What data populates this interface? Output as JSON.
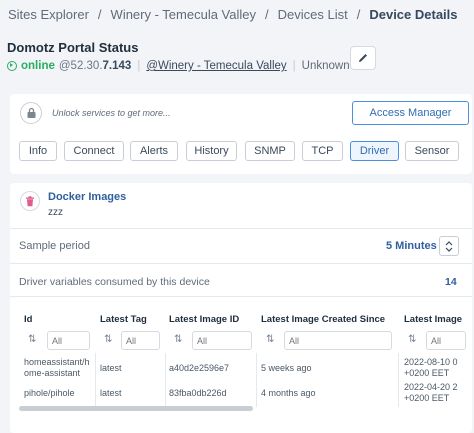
{
  "breadcrumb": {
    "items": [
      "Sites Explorer",
      "Winery - Temecula Valley",
      "Devices List"
    ],
    "current": "Device Details",
    "separator": "/"
  },
  "device": {
    "title": "Domotz Portal Status",
    "status": "online",
    "ip_prefix": "@52.30.",
    "ip_suffix": "7.143",
    "site_link": "@Winery - Temecula Valley",
    "type": "Unknown"
  },
  "services": {
    "unlock_text": "Unlock services to get more...",
    "access_button": "Access Manager",
    "tabs": [
      "Info",
      "Connect",
      "Alerts",
      "History",
      "SNMP",
      "TCP",
      "Driver",
      "Sensor"
    ],
    "active_tab": "Driver"
  },
  "driver": {
    "name": "Docker Images",
    "description": "zzz",
    "sample_period_label": "Sample period",
    "sample_period_value": "5 Minutes",
    "vars_label": "Driver variables consumed by this device",
    "vars_count": "14"
  },
  "table": {
    "columns": [
      "Id",
      "Latest Tag",
      "Latest Image ID",
      "Latest Image Created Since",
      "Latest Image"
    ],
    "filter_placeholder": "All",
    "rows": [
      {
        "id_line1": "homeassistant/h",
        "id_line2": "ome-assistant",
        "tag": "latest",
        "image_id": "a40d2e2596e7",
        "created_since": "5 weeks ago",
        "image_line1": "2022-08-10 0",
        "image_line2": "+0200 EET"
      },
      {
        "id_line1": "pihole/pihole",
        "tag": "latest",
        "image_id": "83fba0db226d",
        "created_since": "4 months ago",
        "image_line1": "2022-04-20 2",
        "image_line2": "+0200 EET"
      }
    ]
  },
  "colors": {
    "online": "#27ae60",
    "accent": "#4a90e2",
    "link": "#2f5f9e",
    "driver_icon": "#e05c8a"
  },
  "icons": [
    "online-icon",
    "pencil-icon",
    "lock-icon",
    "trash-icon",
    "stepper-icon",
    "sort-icon"
  ]
}
